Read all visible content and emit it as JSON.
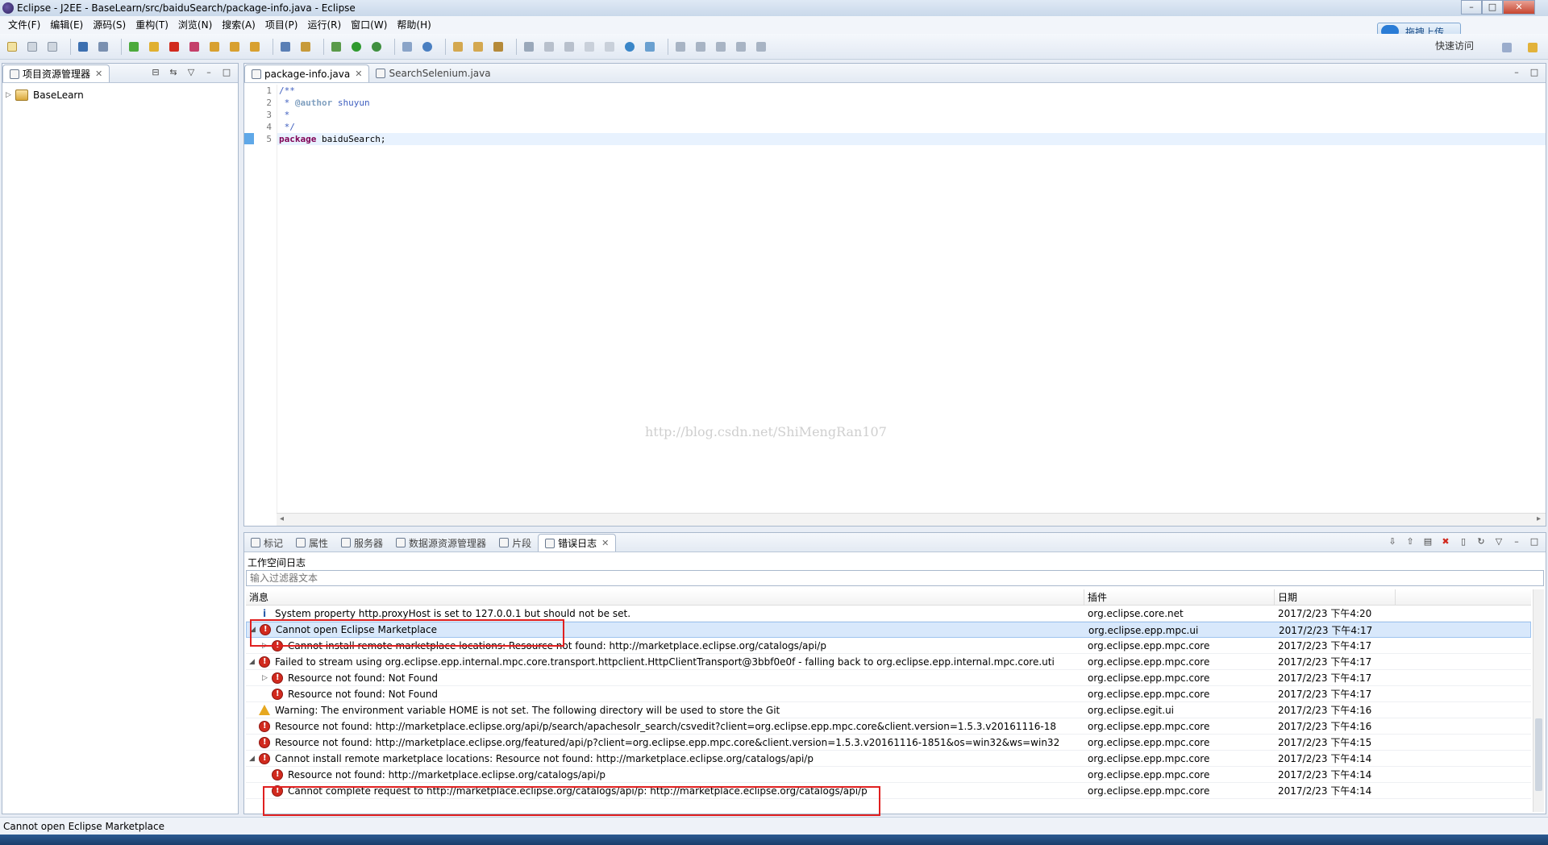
{
  "window": {
    "title": "Eclipse  -  J2EE  -  BaseLearn/src/baiduSearch/package-info.java  -  Eclipse",
    "controls": [
      "–",
      "□",
      "✕"
    ]
  },
  "cloud_upload": {
    "label": "拖拽上传"
  },
  "menu": [
    "文件(F)",
    "编辑(E)",
    "源码(S)",
    "重构(T)",
    "浏览(N)",
    "搜索(A)",
    "项目(P)",
    "运行(R)",
    "窗口(W)",
    "帮助(H)"
  ],
  "toolbar": {
    "quick_access": "快速访问"
  },
  "explorer": {
    "tab_label": "项目资源管理器",
    "items": [
      {
        "label": "BaseLearn"
      }
    ]
  },
  "editor": {
    "tabs": [
      {
        "label": "package-info.java",
        "active": true
      },
      {
        "label": "SearchSelenium.java",
        "active": false
      }
    ],
    "lines": [
      {
        "n": "1",
        "parts": [
          {
            "t": "/**",
            "c": "cm"
          }
        ]
      },
      {
        "n": "2",
        "parts": [
          {
            "t": " * ",
            "c": "cm"
          },
          {
            "t": "@author",
            "c": "tagc"
          },
          {
            "t": " shuyun",
            "c": "cm"
          }
        ]
      },
      {
        "n": "3",
        "parts": [
          {
            "t": " *",
            "c": "cm"
          }
        ]
      },
      {
        "n": "4",
        "parts": [
          {
            "t": " */",
            "c": "cm"
          }
        ]
      },
      {
        "n": "5",
        "parts": [
          {
            "t": "package",
            "c": "kw"
          },
          {
            "t": " baiduSearch;",
            "c": ""
          }
        ]
      }
    ],
    "watermark": "http://blog.csdn.net/ShiMengRan107"
  },
  "bottom_panel": {
    "tabs": [
      {
        "label": "标记",
        "active": false
      },
      {
        "label": "属性",
        "active": false
      },
      {
        "label": "服务器",
        "active": false
      },
      {
        "label": "数据源资源管理器",
        "active": false
      },
      {
        "label": "片段",
        "active": false
      },
      {
        "label": "错误日志",
        "active": true
      }
    ],
    "log_title": "工作空间日志",
    "filter_placeholder": "输入过滤器文本",
    "columns": [
      "消息",
      "插件",
      "日期"
    ],
    "rows": [
      {
        "icon": "info",
        "indent": 0,
        "expander": "",
        "message": "System property http.proxyHost is set to 127.0.0.1 but should not be set.",
        "plugin": "org.eclipse.core.net",
        "date": "2017/2/23 下午4:20"
      },
      {
        "icon": "error",
        "indent": 0,
        "expander": "◢",
        "message": "Cannot open Eclipse Marketplace",
        "plugin": "org.eclipse.epp.mpc.ui",
        "date": "2017/2/23 下午4:17",
        "selected": true
      },
      {
        "icon": "error",
        "indent": 1,
        "expander": "▷",
        "message": "Cannot install remote marketplace locations: Resource not found: http://marketplace.eclipse.org/catalogs/api/p",
        "plugin": "org.eclipse.epp.mpc.core",
        "date": "2017/2/23 下午4:17"
      },
      {
        "icon": "error",
        "indent": 0,
        "expander": "◢",
        "message": "Failed to stream using org.eclipse.epp.internal.mpc.core.transport.httpclient.HttpClientTransport@3bbf0e0f - falling back to org.eclipse.epp.internal.mpc.core.uti",
        "plugin": "org.eclipse.epp.mpc.core",
        "date": "2017/2/23 下午4:17"
      },
      {
        "icon": "error",
        "indent": 1,
        "expander": "▷",
        "message": "Resource not found: Not Found",
        "plugin": "org.eclipse.epp.mpc.core",
        "date": "2017/2/23 下午4:17"
      },
      {
        "icon": "error",
        "indent": 1,
        "expander": "",
        "message": "Resource not found: Not Found",
        "plugin": "org.eclipse.epp.mpc.core",
        "date": "2017/2/23 下午4:17"
      },
      {
        "icon": "warning",
        "indent": 0,
        "expander": "",
        "message": "Warning: The environment variable HOME is not set. The following directory will be used to store the Git",
        "plugin": "org.eclipse.egit.ui",
        "date": "2017/2/23 下午4:16"
      },
      {
        "icon": "error",
        "indent": 0,
        "expander": "",
        "message": "Resource not found: http://marketplace.eclipse.org/api/p/search/apachesolr_search/csvedit?client=org.eclipse.epp.mpc.core&client.version=1.5.3.v20161116-18",
        "plugin": "org.eclipse.epp.mpc.core",
        "date": "2017/2/23 下午4:16"
      },
      {
        "icon": "error",
        "indent": 0,
        "expander": "",
        "message": "Resource not found: http://marketplace.eclipse.org/featured/api/p?client=org.eclipse.epp.mpc.core&client.version=1.5.3.v20161116-1851&os=win32&ws=win32",
        "plugin": "org.eclipse.epp.mpc.core",
        "date": "2017/2/23 下午4:15"
      },
      {
        "icon": "error",
        "indent": 0,
        "expander": "◢",
        "message": "Cannot install remote marketplace locations: Resource not found: http://marketplace.eclipse.org/catalogs/api/p",
        "plugin": "org.eclipse.epp.mpc.core",
        "date": "2017/2/23 下午4:14"
      },
      {
        "icon": "error",
        "indent": 1,
        "expander": "",
        "message": "Resource not found: http://marketplace.eclipse.org/catalogs/api/p",
        "plugin": "org.eclipse.epp.mpc.core",
        "date": "2017/2/23 下午4:14"
      },
      {
        "icon": "error",
        "indent": 1,
        "expander": "",
        "message": "Cannot complete request to http://marketplace.eclipse.org/catalogs/api/p: http://marketplace.eclipse.org/catalogs/api/p",
        "plugin": "org.eclipse.epp.mpc.core",
        "date": "2017/2/23 下午4:14"
      }
    ]
  },
  "status": {
    "text": "Cannot open Eclipse Marketplace"
  },
  "colors": {
    "error": "#d12a1e",
    "warning": "#e6a820",
    "highlight": "#e02020",
    "selection": "#d8e8fb"
  }
}
